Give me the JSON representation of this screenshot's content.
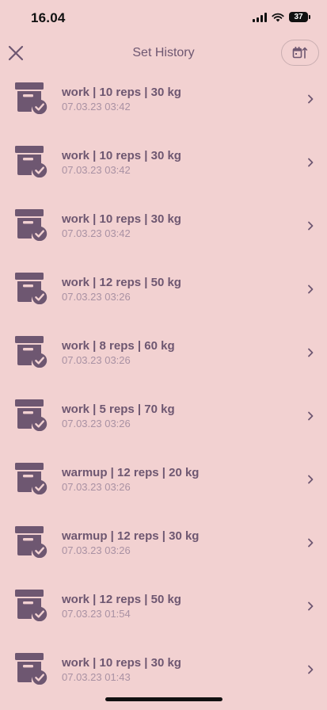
{
  "status_bar": {
    "time": "16.04",
    "battery": "37"
  },
  "nav": {
    "title": "Set History",
    "close_icon": "close-icon",
    "sort_icon": "calendar-sort-icon"
  },
  "colors": {
    "background": "#f2d1d1",
    "primary": "#6e5771",
    "secondary": "#a991a3"
  },
  "items": [
    {
      "title": "work | 10 reps | 30 kg",
      "subtitle": "07.03.23 03:42"
    },
    {
      "title": "work | 10 reps | 30 kg",
      "subtitle": "07.03.23 03:42"
    },
    {
      "title": "work | 10 reps | 30 kg",
      "subtitle": "07.03.23 03:42"
    },
    {
      "title": "work | 12 reps | 50 kg",
      "subtitle": "07.03.23 03:26"
    },
    {
      "title": "work | 8 reps | 60 kg",
      "subtitle": "07.03.23 03:26"
    },
    {
      "title": "work | 5 reps | 70 kg",
      "subtitle": "07.03.23 03:26"
    },
    {
      "title": "warmup | 12 reps | 20 kg",
      "subtitle": "07.03.23 03:26"
    },
    {
      "title": "warmup | 12 reps | 30 kg",
      "subtitle": "07.03.23 03:26"
    },
    {
      "title": "work | 12 reps | 50 kg",
      "subtitle": "07.03.23 01:54"
    },
    {
      "title": "work | 10 reps | 30 kg",
      "subtitle": "07.03.23 01:43"
    }
  ]
}
